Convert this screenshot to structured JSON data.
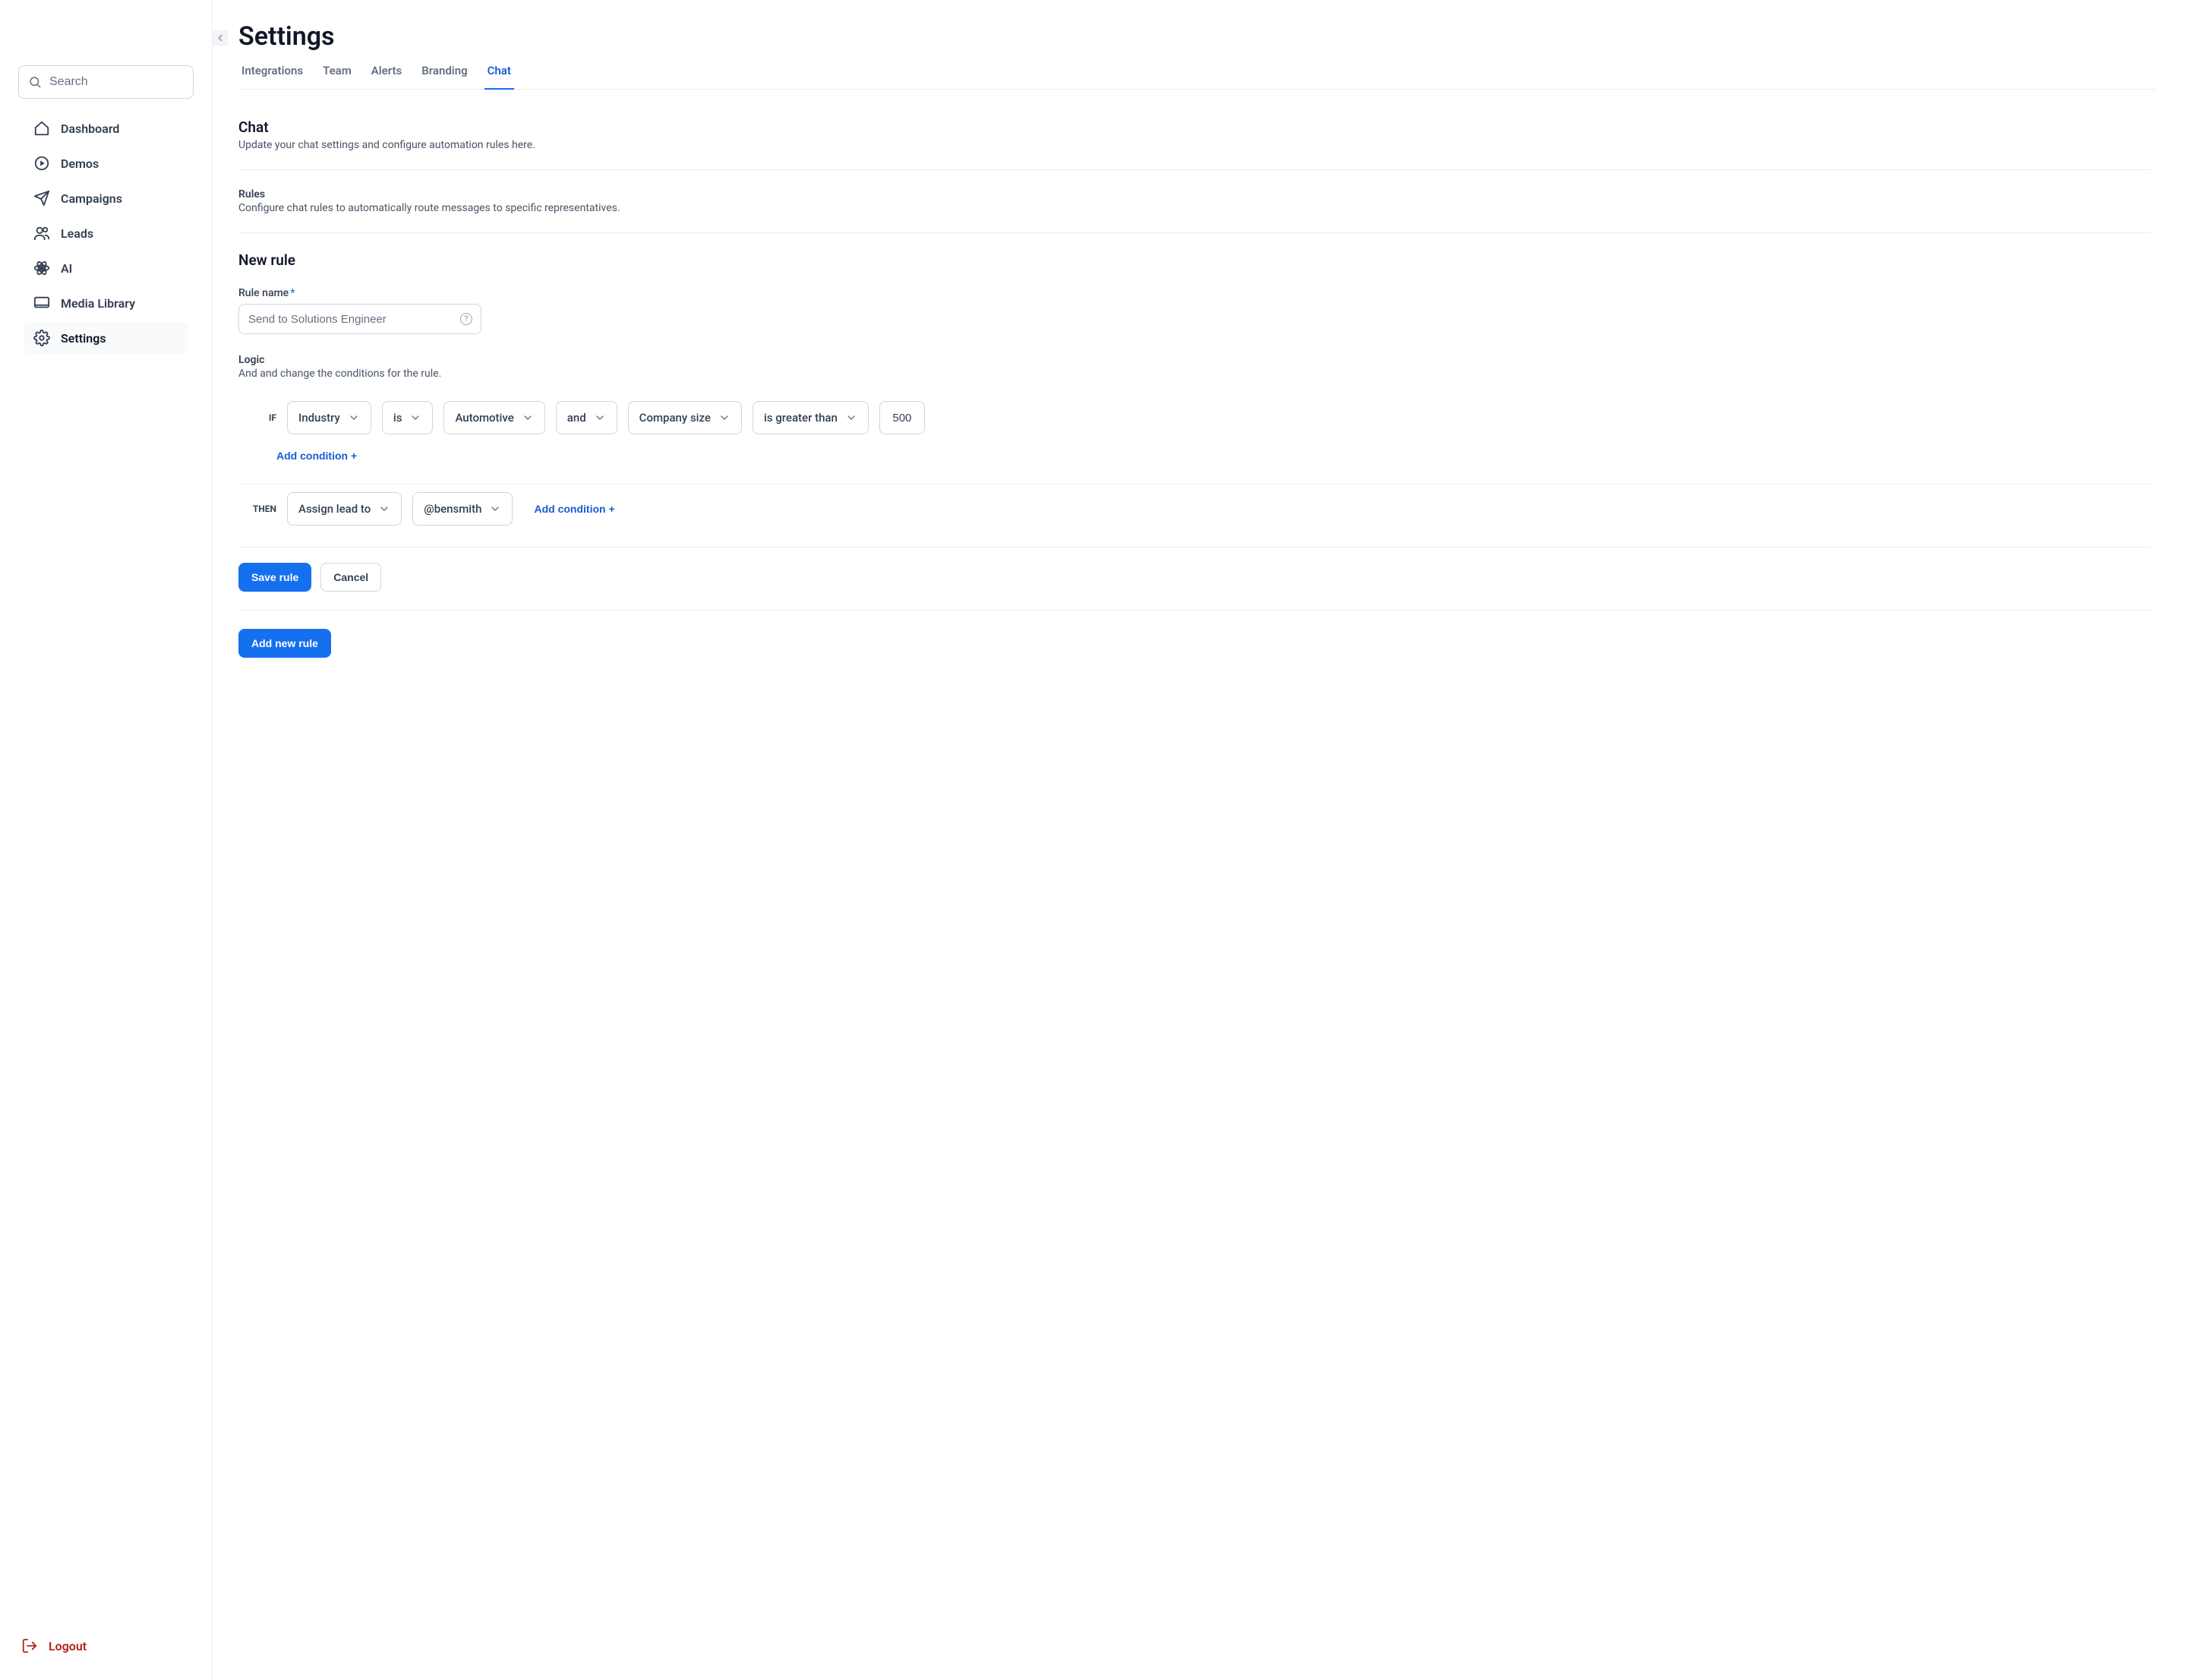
{
  "sidebar": {
    "search_placeholder": "Search",
    "items": [
      {
        "label": "Dashboard",
        "icon": "home"
      },
      {
        "label": "Demos",
        "icon": "play"
      },
      {
        "label": "Campaigns",
        "icon": "send"
      },
      {
        "label": "Leads",
        "icon": "users"
      },
      {
        "label": "AI",
        "icon": "atom"
      },
      {
        "label": "Media Library",
        "icon": "monitor"
      },
      {
        "label": "Settings",
        "icon": "gear"
      }
    ],
    "active_index": 6,
    "logout_label": "Logout"
  },
  "page": {
    "title": "Settings",
    "tabs": [
      "Integrations",
      "Team",
      "Alerts",
      "Branding",
      "Chat"
    ],
    "active_tab_index": 4
  },
  "chat": {
    "heading": "Chat",
    "subheading": "Update your chat settings and configure automation rules here."
  },
  "rules": {
    "heading": "Rules",
    "subheading": "Configure chat rules to automatically route messages to specific representatives."
  },
  "new_rule": {
    "heading": "New rule",
    "name_label": "Rule name",
    "name_required": "*",
    "name_placeholder": "Send to Solutions Engineer",
    "logic_heading": "Logic",
    "logic_sub": "And and change the conditions for the rule.",
    "if_label": "IF",
    "then_label": "THEN",
    "if_conditions": {
      "field1": "Industry",
      "op1": "is",
      "value1": "Automotive",
      "joiner": "and",
      "field2": "Company size",
      "op2": "is greater than",
      "value2": "500"
    },
    "then_conditions": {
      "action": "Assign lead to",
      "target": "@bensmith"
    },
    "add_condition_label": "Add condition +",
    "save_label": "Save rule",
    "cancel_label": "Cancel",
    "add_new_rule_label": "Add new rule"
  }
}
